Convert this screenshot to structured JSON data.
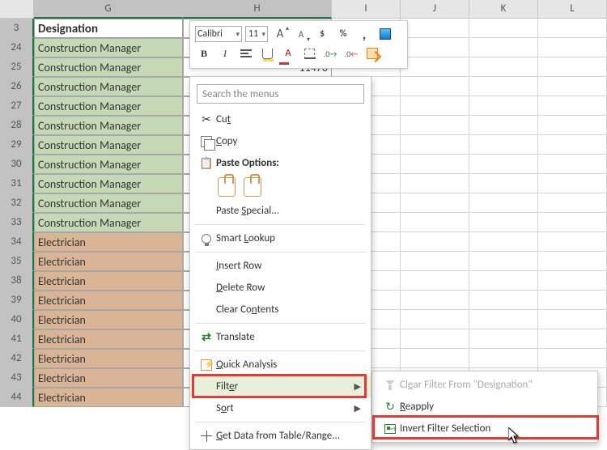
{
  "columns": {
    "G": "G",
    "H": "H",
    "I": "I",
    "J": "J",
    "K": "K",
    "L": "L"
  },
  "header_cell": "Designation",
  "row_numbers": [
    "3",
    "24",
    "25",
    "26",
    "27",
    "28",
    "29",
    "30",
    "31",
    "32",
    "33",
    "34",
    "35",
    "38",
    "39",
    "40",
    "41",
    "42",
    "43",
    "44"
  ],
  "rows": {
    "g_vals": [
      "Construction Manager",
      "Construction Manager",
      "Construction Manager",
      "Construction Manager",
      "Construction Manager",
      "Construction Manager",
      "Construction Manager",
      "Construction Manager",
      "Construction Manager",
      "Construction Manager",
      "Electrician",
      "Electrician",
      "Electrician",
      "Electrician",
      "Electrician",
      "Electrician",
      "Electrician",
      "Electrician",
      "Electrician"
    ],
    "g_classes": [
      "g-green",
      "g-green",
      "g-green",
      "g-green",
      "g-green",
      "g-green",
      "g-green",
      "g-green",
      "g-green",
      "g-green",
      "g-brown",
      "g-brown",
      "g-brown",
      "g-brown",
      "g-brown",
      "g-brown",
      "g-brown",
      "g-brown",
      "g-brown"
    ],
    "h_partial": "11470"
  },
  "mini_toolbar": {
    "font": "Calibri",
    "size": "11"
  },
  "context_menu": {
    "search_placeholder": "Search the menus",
    "cut": "Cut",
    "copy": "Copy",
    "paste_opts": "Paste Options:",
    "paste_special": "Paste Special...",
    "smart_lookup": "Smart Lookup",
    "insert_row": "Insert Row",
    "delete_row": "Delete Row",
    "clear_contents": "Clear Contents",
    "translate": "Translate",
    "quick_analysis": "Quick Analysis",
    "filter": "Filter",
    "sort": "Sort",
    "get_data": "Get Data from Table/Range..."
  },
  "submenu": {
    "clear_filter": "Clear Filter From \"Designation\"",
    "reapply": "Reapply",
    "invert": "Invert Filter Selection"
  }
}
